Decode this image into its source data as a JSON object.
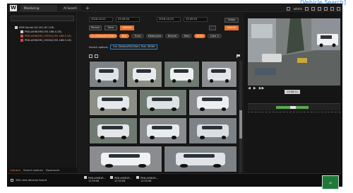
{
  "banner": {
    "text": "[Vehicle Search]"
  },
  "titlebar": {
    "logo": "W",
    "tabs": [
      "Monitoring",
      "AI Search"
    ],
    "add_tab": "+",
    "user": "admin"
  },
  "left_panel": {
    "tree": [
      {
        "label": "SSM Server(10.101.67.116)",
        "level": 0
      },
      {
        "label": "PND-A9081RV(192.168.0.16)",
        "level": 1
      },
      {
        "label": "PND-A9081RV_CH001(192.168.0.16)",
        "level": 1
      },
      {
        "label": "PND-A9081RV_CH002(192.168.0.16)",
        "level": 1
      }
    ],
    "bottom_tabs": [
      "Camera",
      "Search options",
      "Bookmark"
    ]
  },
  "controls": {
    "date_from": "2016-10-21",
    "time_from": "03:49:20",
    "date_to": "2016-10-24",
    "time_to": "15:49:20",
    "today_label": "Today",
    "tabs": [
      "Person",
      "Face",
      "Vehicle"
    ],
    "active_tab": "Vehicle",
    "vehicle_types": [
      "Car (Sedan/SUV/Van)",
      "Bus",
      "Truck",
      "Motorcycle",
      "Bicycle",
      "Train",
      "White",
      "Color 2"
    ],
    "active_types": [
      "Car (Sedan/SUV/Van)",
      "Bus",
      "White"
    ],
    "search_label": "Search",
    "search_options_label": "Search options",
    "search_options_tag": "Car (Sedan/SUV/Van), Bus, White"
  },
  "results": {
    "thumbnails": [
      {
        "name": "white-pickup-1",
        "color": "#dfe3e6"
      },
      {
        "name": "white-suv-1",
        "color": "#e8ebee"
      },
      {
        "name": "white-van-1",
        "color": "#edeff1"
      },
      {
        "name": "white-car-1",
        "color": "#e2e6ea"
      },
      {
        "name": "white-pickup-2",
        "color": "#e6e9ec"
      },
      {
        "name": "white-suv-2",
        "color": "#dfe2e5"
      },
      {
        "name": "white-car-2",
        "color": "#eceef0"
      },
      {
        "name": "white-van-2",
        "color": "#e4e7ea"
      },
      {
        "name": "white-suv-3",
        "color": "#e9ecef"
      },
      {
        "name": "white-car-3",
        "color": "#dcdfe2"
      },
      {
        "name": "white-bus-1",
        "color": "#f0f1f2"
      },
      {
        "name": "white-car-4",
        "color": "#e1e4e7"
      }
    ]
  },
  "player": {
    "time": "13:08:11",
    "controls": [
      "◀",
      "▶",
      "▶▶"
    ]
  },
  "status": {
    "devices_found": "284 new devices found",
    "notifications": [
      {
        "title": "PND-A9081R...",
        "time": "12:55:06"
      },
      {
        "title": "PND-A9081R...",
        "time": "12:55:06"
      },
      {
        "title": "PND-A9081R...",
        "time": "12:55:06"
      }
    ]
  },
  "corner_logo": "AI"
}
